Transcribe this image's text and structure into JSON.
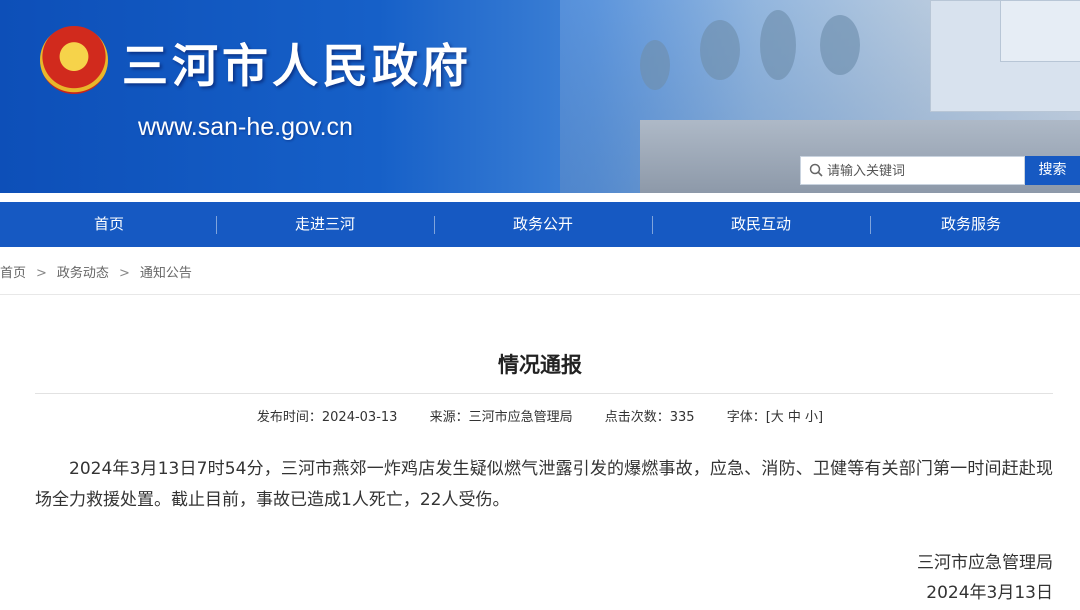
{
  "header": {
    "title": "三河市人民政府",
    "url": "www.san-he.gov.cn",
    "search_placeholder": "请输入关键词",
    "search_button": "搜索"
  },
  "nav": {
    "items": [
      {
        "label": "首页"
      },
      {
        "label": "走进三河"
      },
      {
        "label": "政务公开"
      },
      {
        "label": "政民互动"
      },
      {
        "label": "政务服务"
      }
    ]
  },
  "breadcrumb": {
    "items": [
      "首页",
      "政务动态",
      "通知公告"
    ],
    "separator": ">"
  },
  "article": {
    "title": "情况通报",
    "meta": {
      "publish_time": "发布时间：2024-03-13",
      "source": "来源：三河市应急管理局",
      "views": "点击次数：335",
      "font_size": "字体：[大 中 小]"
    },
    "body": "2024年3月13日7时54分，三河市燕郊一炸鸡店发生疑似燃气泄露引发的爆燃事故，应急、消防、卫健等有关部门第一时间赶赴现场全力救援处置。截止目前，事故已造成1人死亡，22人受伤。",
    "signature": "三河市应急管理局",
    "date": "2024年3月13日"
  },
  "icons": {
    "emblem": "national-emblem-icon",
    "search": "search-icon"
  },
  "colors": {
    "nav_blue": "#1659c2",
    "header_blue": "#0d4fb8"
  }
}
